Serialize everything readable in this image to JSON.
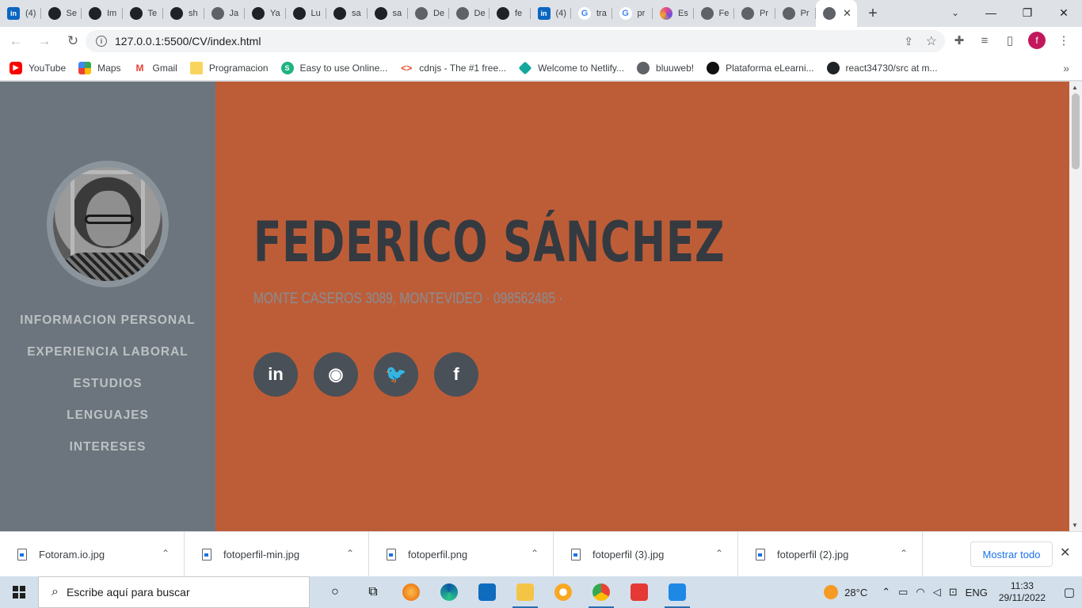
{
  "browser": {
    "tabs": [
      {
        "icon": "linkedin-icon",
        "label": "(4)"
      },
      {
        "icon": "github-icon",
        "label": "Se"
      },
      {
        "icon": "github-icon",
        "label": "Im"
      },
      {
        "icon": "github-icon",
        "label": "Te"
      },
      {
        "icon": "github-icon",
        "label": "sh"
      },
      {
        "icon": "globe-icon",
        "label": "Ja"
      },
      {
        "icon": "github-icon",
        "label": "Ya"
      },
      {
        "icon": "github-icon",
        "label": "Lu"
      },
      {
        "icon": "github-icon",
        "label": "sa"
      },
      {
        "icon": "github-icon",
        "label": "sa"
      },
      {
        "icon": "globe-icon",
        "label": "De"
      },
      {
        "icon": "globe-icon",
        "label": "De"
      },
      {
        "icon": "github-icon",
        "label": "fe"
      },
      {
        "icon": "linkedin-icon",
        "label": "(4)"
      },
      {
        "icon": "google-icon",
        "label": "tra"
      },
      {
        "icon": "google-icon",
        "label": "pr"
      },
      {
        "icon": "ring-icon",
        "label": "Es"
      },
      {
        "icon": "globe-icon",
        "label": "Fe"
      },
      {
        "icon": "globe-icon",
        "label": "Pr"
      },
      {
        "icon": "globe-icon",
        "label": "Pr"
      }
    ],
    "active_tab_close": "✕",
    "new_tab": "+",
    "url": "127.0.0.1:5500/CV/index.html",
    "profile_initial": "f",
    "bookmarks": [
      {
        "icon": "youtube-icon",
        "label": "YouTube"
      },
      {
        "icon": "maps-icon",
        "label": "Maps"
      },
      {
        "icon": "gmail-icon",
        "label": "Gmail"
      },
      {
        "icon": "folder-icon",
        "label": "Programacion"
      },
      {
        "icon": "easy-icon",
        "label": "Easy to use Online..."
      },
      {
        "icon": "cdnjs-icon",
        "label": "cdnjs - The #1 free..."
      },
      {
        "icon": "netlify-icon",
        "label": "Welcome to Netlify..."
      },
      {
        "icon": "globe-icon",
        "label": "bluuweb!"
      },
      {
        "icon": "platform-icon",
        "label": "Plataforma eLearni..."
      },
      {
        "icon": "github-icon",
        "label": "react34730/src at m..."
      }
    ]
  },
  "page": {
    "nav": [
      "INFORMACION PERSONAL",
      "EXPERIENCIA LABORAL",
      "ESTUDIOS",
      "LENGUAJES",
      "INTERESES"
    ],
    "name": "FEDERICO SÁNCHEZ",
    "subheading": "MONTE CASEROS 3089, MONTEVIDEO · 098562485 ·",
    "social": [
      {
        "icon": "linkedin-icon",
        "glyph": "in"
      },
      {
        "icon": "github-icon",
        "glyph": "◉"
      },
      {
        "icon": "twitter-icon",
        "glyph": "🐦"
      },
      {
        "icon": "facebook-icon",
        "glyph": "f"
      }
    ],
    "colors": {
      "sidebar": "#6c757d",
      "main": "#bd5d38",
      "heading": "#343a40",
      "subheading": "#868e96"
    }
  },
  "downloads": {
    "items": [
      "Fotoram.io.jpg",
      "fotoperfil-min.jpg",
      "fotoperfil.png",
      "fotoperfil (3).jpg",
      "fotoperfil (2).jpg"
    ],
    "show_all": "Mostrar todo"
  },
  "taskbar": {
    "search_placeholder": "Escribe aquí para buscar",
    "weather": "28°C",
    "language": "ENG",
    "time": "11:33",
    "date": "29/11/2022"
  }
}
